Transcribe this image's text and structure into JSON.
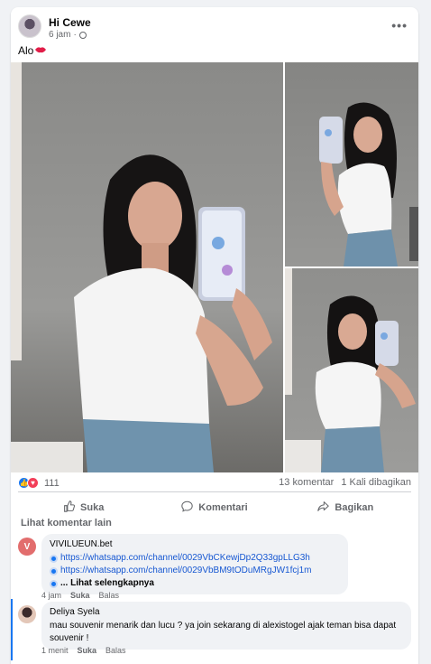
{
  "post": {
    "author": "Hi Cewe",
    "time": "6 jam",
    "text": "Alo",
    "more": "•••"
  },
  "stats": {
    "reactions": "111",
    "comments": "13 komentar",
    "shares": "1 Kali dibagikan"
  },
  "actions": {
    "like": "Suka",
    "comment": "Komentari",
    "share": "Bagikan"
  },
  "comments_header": "Lihat komentar lain",
  "comments": [
    {
      "initial": "V",
      "name": "VIVILUEUN.bet",
      "links": [
        "https://whatsapp.com/channel/0029VbCKewjDp2Q33gpLLG3h",
        "https://whatsapp.com/channel/0029VbBM9tODuMRgJW1fcj1m"
      ],
      "see_more": "... Lihat selengkapnya",
      "time": "4 jam",
      "like": "Suka",
      "reply": "Balas"
    },
    {
      "name": "Deliya Syela",
      "text": "mau souvenir menarik dan lucu ? ya join sekarang di alexistogel ajak teman bisa dapat souvenir !",
      "time": "1 menit",
      "like": "Suka",
      "reply": "Balas"
    }
  ],
  "colors": {
    "accent": "#1877f2",
    "link": "#1758d2",
    "love": "#f33e58",
    "v_avatar": "#e26d6d"
  }
}
